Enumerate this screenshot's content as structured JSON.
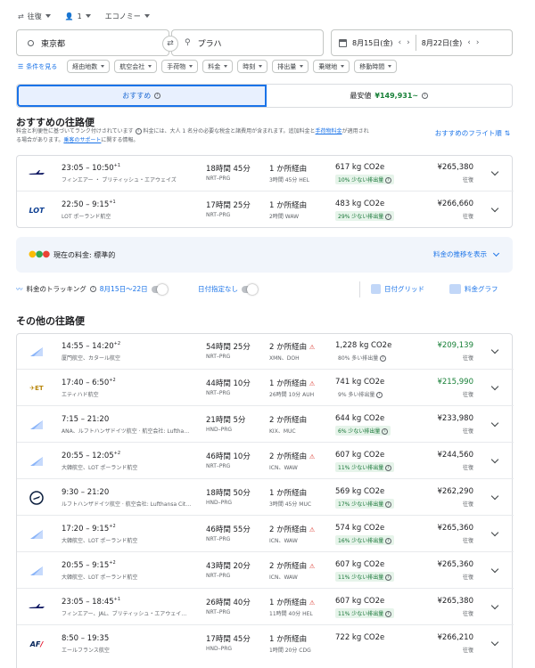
{
  "topbar": {
    "trip_type": "往復",
    "passengers": "1",
    "cabin": "エコノミー"
  },
  "search": {
    "origin": "東京都",
    "destination": "プラハ",
    "depart_date": "8月15日(金)",
    "return_date": "8月22日(金)"
  },
  "filters": {
    "all_filters": "条件を見る",
    "chips": [
      "経由地数",
      "航空会社",
      "手荷物",
      "料金",
      "時刻",
      "排出量",
      "乗継地",
      "移動時間"
    ]
  },
  "tabs": {
    "best": "おすすめ",
    "cheapest_label": "最安値",
    "cheapest_price": "¥149,931~"
  },
  "recommended": {
    "title": "おすすめの往路便",
    "note_line1": "料金と利便性に基づいてランク付けされています",
    "note_line1b": "料金には、大人 1 名分の必要な税金と諸費用が含まれます。追加料金と",
    "note_link": "手荷物料金",
    "note_line1c": "が適用され",
    "note_line2": "る場合があります。",
    "note_link2": "乗客のサポート",
    "note_line2b": "に関する情報。",
    "sort_label": "おすすめのフライト順",
    "flights": [
      {
        "logo": "finnair",
        "times": "23:05 – 10:50",
        "sup": "+1",
        "airline": "フィンエアー ・ ブリティッシュ・エアウェイズ",
        "duration": "18時間 45分",
        "route": "NRT–PRG",
        "stops": "1 か所経由",
        "warn": false,
        "stop_detail": "3時間 45分 HEL",
        "co2": "617 kg CO2e",
        "emission": "10% 少ない排出量",
        "emission_type": "less",
        "price": "¥265,380",
        "price_green": false,
        "trip": "往復"
      },
      {
        "logo": "lot",
        "times": "22:50 – 9:15",
        "sup": "+1",
        "airline": "LOT ポーランド航空",
        "duration": "17時間 25分",
        "route": "NRT–PRG",
        "stops": "1 か所経由",
        "warn": false,
        "stop_detail": "2時間 WAW",
        "co2": "483 kg CO2e",
        "emission": "29% 少ない排出量",
        "emission_type": "less",
        "price": "¥266,660",
        "price_green": false,
        "trip": "往復"
      }
    ]
  },
  "price_insight": {
    "text": "現在の料金: 標準的",
    "link": "料金の推移を表示"
  },
  "tools": {
    "tracking": "料金のトラッキング",
    "tracking_dates": "8月15日～22日",
    "any_dates": "日付指定なし",
    "date_grid": "日付グリッド",
    "price_graph": "料金グラフ"
  },
  "other": {
    "title": "その他の往路便",
    "flights": [
      {
        "logo": "xiamen",
        "times": "14:55 – 14:20",
        "sup": "+2",
        "airline": "厦門航空、カタール航空",
        "duration": "54時間 25分",
        "route": "NRT–PRG",
        "stops": "2 か所経由",
        "warn": true,
        "stop_detail": "XMN、DOH",
        "co2": "1,228 kg CO2e",
        "emission": "80% 多い排出量",
        "emission_type": "more",
        "price": "¥209,139",
        "price_green": true,
        "trip": "往復"
      },
      {
        "logo": "etihad",
        "times": "17:40 – 6:50",
        "sup": "+2",
        "airline": "エティハド航空",
        "duration": "44時間 10分",
        "route": "NRT–PRG",
        "stops": "1 か所経由",
        "warn": true,
        "stop_detail": "26時間 10分 AUH",
        "co2": "741 kg CO2e",
        "emission": "9% 多い排出量",
        "emission_type": "more",
        "price": "¥215,990",
        "price_green": true,
        "trip": "往復"
      },
      {
        "logo": "ana",
        "times": "7:15 – 21:20",
        "sup": "",
        "airline": "ANA、ルフトハンザドイツ航空 · 航空会社: Luftha…",
        "duration": "21時間 5分",
        "route": "HND–PRG",
        "stops": "2 か所経由",
        "warn": false,
        "stop_detail": "KIX、MUC",
        "co2": "644 kg CO2e",
        "emission": "6% 少ない排出量",
        "emission_type": "less",
        "price": "¥233,980",
        "price_green": false,
        "trip": "往復"
      },
      {
        "logo": "korean",
        "times": "20:55 – 12:05",
        "sup": "+2",
        "airline": "大韓航空、LOT ポーランド航空",
        "duration": "46時間 10分",
        "route": "NRT–PRG",
        "stops": "2 か所経由",
        "warn": true,
        "stop_detail": "ICN、WAW",
        "co2": "607 kg CO2e",
        "emission": "11% 少ない排出量",
        "emission_type": "less",
        "price": "¥244,560",
        "price_green": false,
        "trip": "往復"
      },
      {
        "logo": "lufthansa",
        "times": "9:30 – 21:20",
        "sup": "",
        "airline": "ルフトハンザドイツ航空 · 航空会社: Lufthansa Cit…",
        "duration": "18時間 50分",
        "route": "HND–PRG",
        "stops": "1 か所経由",
        "warn": false,
        "stop_detail": "3時間 45分 MUC",
        "co2": "569 kg CO2e",
        "emission": "17% 少ない排出量",
        "emission_type": "less",
        "price": "¥262,290",
        "price_green": false,
        "trip": "往復"
      },
      {
        "logo": "korean",
        "times": "17:20 – 9:15",
        "sup": "+2",
        "airline": "大韓航空、LOT ポーランド航空",
        "duration": "46時間 55分",
        "route": "NRT–PRG",
        "stops": "2 か所経由",
        "warn": true,
        "stop_detail": "ICN、WAW",
        "co2": "574 kg CO2e",
        "emission": "16% 少ない排出量",
        "emission_type": "less",
        "price": "¥265,360",
        "price_green": false,
        "trip": "往復"
      },
      {
        "logo": "korean",
        "times": "20:55 – 9:15",
        "sup": "+2",
        "airline": "大韓航空、LOT ポーランド航空",
        "duration": "43時間 20分",
        "route": "NRT–PRG",
        "stops": "2 か所経由",
        "warn": true,
        "stop_detail": "ICN、WAW",
        "co2": "607 kg CO2e",
        "emission": "11% 少ない排出量",
        "emission_type": "less",
        "price": "¥265,360",
        "price_green": false,
        "trip": "往復"
      },
      {
        "logo": "finnair",
        "times": "23:05 – 18:45",
        "sup": "+1",
        "airline": "フィンエアー、JAL、ブリティッシュ・エアウェイ…",
        "duration": "26時間 40分",
        "route": "NRT–PRG",
        "stops": "1 か所経由",
        "warn": true,
        "stop_detail": "11時間 40分 HEL",
        "co2": "607 kg CO2e",
        "emission": "11% 少ない排出量",
        "emission_type": "less",
        "price": "¥265,380",
        "price_green": false,
        "trip": "往復"
      },
      {
        "logo": "airfrance",
        "times": "8:50 – 19:35",
        "sup": "",
        "airline": "エールフランス航空",
        "duration": "17時間 45分",
        "route": "HND–PRG",
        "stops": "1 か所経由",
        "warn": false,
        "stop_detail": "1時間 20分 CDG",
        "co2": "722 kg CO2e",
        "emission": "",
        "emission_type": "more",
        "price": "¥266,210",
        "price_green": false,
        "trip": "往復"
      }
    ]
  },
  "colors": {
    "accent": "#1a73e8",
    "green": "#188038",
    "warn": "#d93025"
  }
}
